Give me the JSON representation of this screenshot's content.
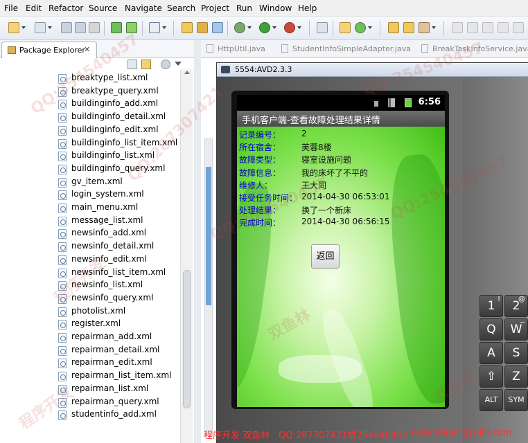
{
  "menu": [
    "File",
    "Edit",
    "Refactor",
    "Source",
    "Navigate",
    "Search",
    "Project",
    "Run",
    "Window",
    "Help"
  ],
  "package_explorer": {
    "title": "Package Explorer",
    "close_symbol": "✕",
    "files": [
      "breaktype_list.xml",
      "breaktype_query.xml",
      "buildinginfo_add.xml",
      "buildinginfo_detail.xml",
      "buildinginfo_edit.xml",
      "buildinginfo_list_item.xml",
      "buildinginfo_list.xml",
      "buildinginfo_query.xml",
      "gv_item.xml",
      "login_system.xml",
      "main_menu.xml",
      "message_list.xml",
      "newsinfo_add.xml",
      "newsinfo_detail.xml",
      "newsinfo_edit.xml",
      "newsinfo_list_item.xml",
      "newsinfo_list.xml",
      "newsinfo_query.xml",
      "photolist.xml",
      "register.xml",
      "repairman_add.xml",
      "repairman_detail.xml",
      "repairman_edit.xml",
      "repairman_list_item.xml",
      "repairman_list.xml",
      "repairman_query.xml",
      "studentinfo_add.xml"
    ]
  },
  "editor_tabs": [
    "HttpUtil.java",
    "StudentInfoSimpleAdapter.java",
    "BreakTaskInfoService.java"
  ],
  "emulator": {
    "title": "5554:AVD2.3.3",
    "clock": "6:56",
    "app_title": "手机客户端-查看故障处理结果详情",
    "fields": [
      {
        "label": "记录编号：",
        "value": "2"
      },
      {
        "label": "所在宿舍：",
        "value": "芙蓉8楼"
      },
      {
        "label": "故障类型：",
        "value": "寝室设施问题"
      },
      {
        "label": "故障信息：",
        "value": "我的床坏了不平的"
      },
      {
        "label": "维修人：",
        "value": "王大同"
      },
      {
        "label": "接受任务时间：",
        "value": "2014-04-30 06:53:01"
      },
      {
        "label": "处理结果：",
        "value": "换了一个新床"
      },
      {
        "label": "完成时间：",
        "value": "2014-04-30 06:56:15"
      }
    ],
    "back_button": "返回",
    "keys": [
      {
        "main": "1",
        "sub": "!"
      },
      {
        "main": "2",
        "sub": "@"
      },
      {
        "main": "Q",
        "sub": ""
      },
      {
        "main": "W",
        "sub": "~"
      },
      {
        "main": "A",
        "sub": ""
      },
      {
        "main": "S",
        "sub": ""
      },
      {
        "main": "⇧",
        "sub": ""
      },
      {
        "main": "Z",
        "sub": ""
      },
      {
        "main": "ALT",
        "sub": ""
      },
      {
        "main": "SYM",
        "sub": ""
      }
    ]
  },
  "footer": {
    "dev": "程序开发:双鱼林",
    "qq": "QQ:287307421或254540457",
    "site": "www.shuangyulin.com"
  },
  "watermarks": [
    "QQ:254540457",
    "程序开发",
    "双鱼林",
    "QQ:287307421"
  ]
}
